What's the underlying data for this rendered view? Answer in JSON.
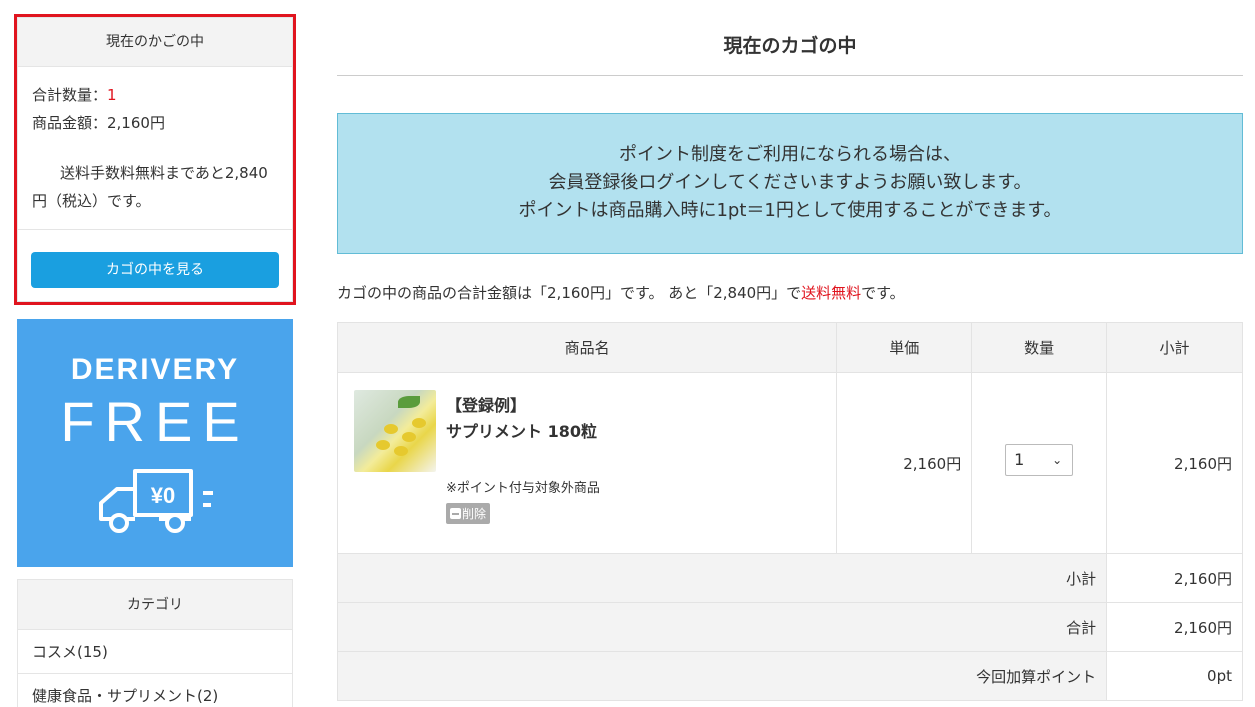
{
  "cart_widget": {
    "title": "現在のかごの中",
    "qty_label": "合計数量：",
    "qty_value": "1",
    "amount_label": "商品金額：2,160円",
    "shipping_note": "送料手数料無料まであと2,840円（税込）です。",
    "view_button": "カゴの中を見る"
  },
  "banner": {
    "line1": "DERIVERY",
    "line2": "FREE",
    "price_tag": "¥0"
  },
  "category": {
    "title": "カテゴリ",
    "items": [
      {
        "label": "コスメ(15)"
      },
      {
        "label": "健康食品・サプリメント(2)"
      }
    ]
  },
  "main": {
    "title": "現在のカゴの中",
    "notice": [
      "ポイント制度をご利用になられる場合は、",
      "会員登録後ログインしてくださいますようお願い致します。",
      "ポイントは商品購入時に1pt＝1円として使用することができます。"
    ],
    "summary_pre": "カゴの中の商品の合計金額は「2,160円」です。 あと「2,840円」で",
    "summary_red": "送料無料",
    "summary_post": "です。"
  },
  "table": {
    "headers": {
      "name": "商品名",
      "price": "単価",
      "qty": "数量",
      "subtotal": "小計"
    },
    "item": {
      "name_line1": "【登録例】",
      "name_line2": "サプリメント 180粒",
      "note": "※ポイント付与対象外商品",
      "delete_label": "削除",
      "price": "2,160円",
      "qty": "1",
      "subtotal": "2,160円"
    },
    "totals": [
      {
        "label": "小計",
        "value": "2,160円"
      },
      {
        "label": "合計",
        "value": "2,160円"
      },
      {
        "label": "今回加算ポイント",
        "value": "0pt"
      }
    ]
  },
  "colors": {
    "accent_red": "#e0141e",
    "button_blue": "#1a9fe0",
    "banner_blue": "#4aa4ec",
    "notice_bg": "#b2e1ef"
  }
}
